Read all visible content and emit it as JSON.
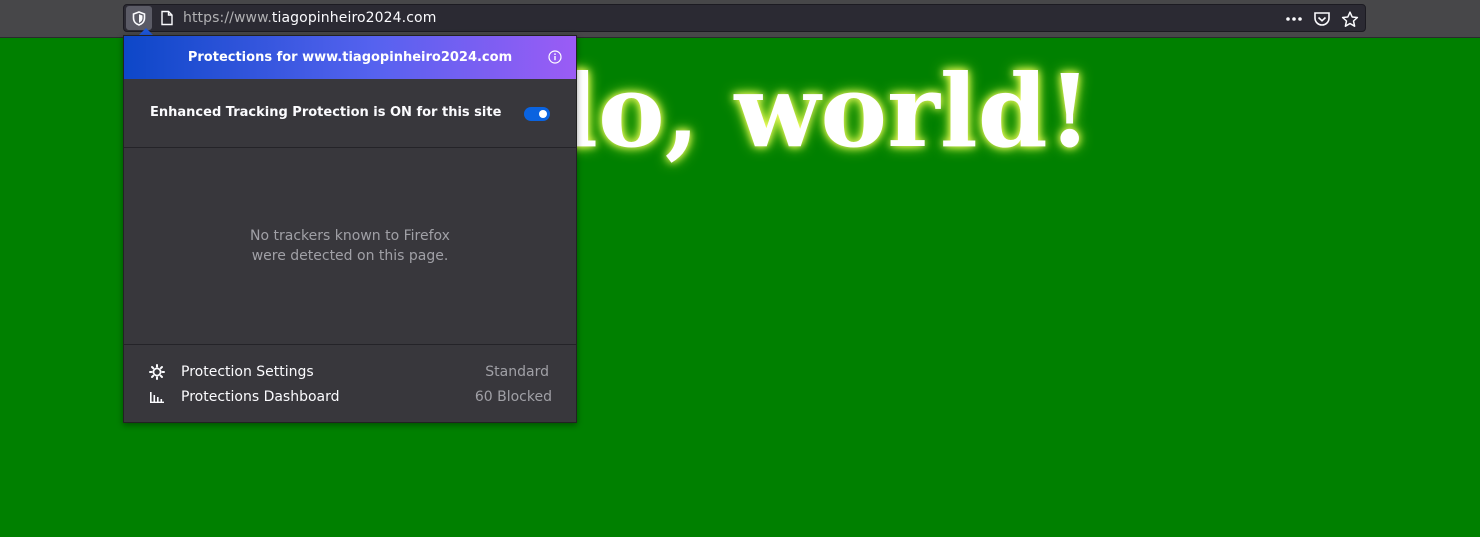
{
  "browser": {
    "url_prefix": "https://www.",
    "url_domain": "tiagopinheiro2024.com",
    "icons": [
      "shield-icon",
      "page-icon",
      "more-icon",
      "pocket-icon",
      "bookmark-star-icon"
    ]
  },
  "page": {
    "heading_visible": "lo, world!",
    "background_color": "#008000"
  },
  "protections_panel": {
    "title": "Protections for www.tiagopinheiro2024.com",
    "etp_label": "Enhanced Tracking Protection is ON for this site",
    "etp_enabled": true,
    "empty_message_line1": "No trackers known to Firefox",
    "empty_message_line2": "were detected on this page.",
    "settings_label": "Protection Settings",
    "settings_value": "Standard",
    "dashboard_label": "Protections Dashboard",
    "dashboard_value": "60 Blocked",
    "accent_color": "#0a63e0"
  }
}
